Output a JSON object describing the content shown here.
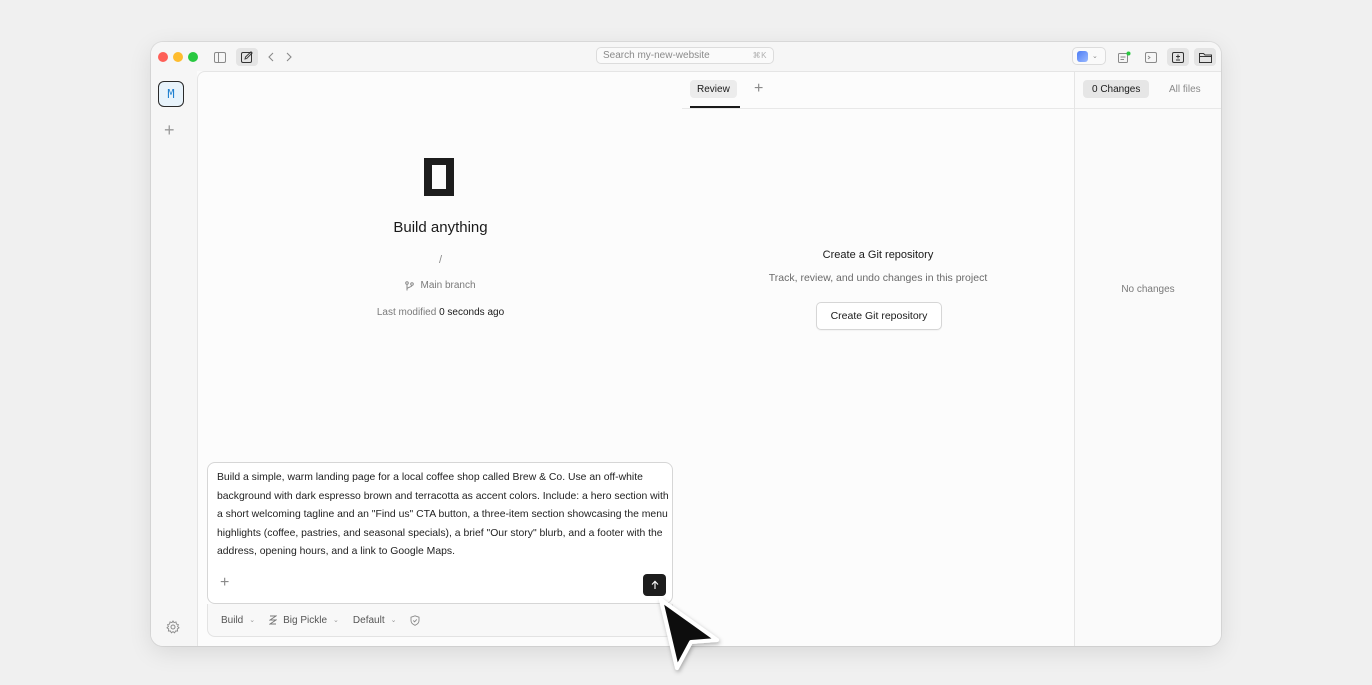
{
  "titlebar": {
    "search_placeholder": "Search my-new-website",
    "search_shortcut": "⌘K"
  },
  "rail": {
    "project_initial": "M"
  },
  "session": {
    "title": "Build anything",
    "path": "/",
    "branch": "Main branch",
    "modified_label": "Last modified",
    "modified_value": "0 seconds ago"
  },
  "composer": {
    "prompt": "Build a simple, warm landing page for a local coffee shop called Brew & Co. Use an off-white background with dark espresso brown and terracotta as accent colors. Include: a hero section with a short welcoming tagline and an \"Find us\" CTA button, a three-item section showcasing the menu highlights (coffee, pastries, and seasonal specials), a brief \"Our story\" blurb, and a footer with the address, opening hours, and a link to Google Maps.",
    "agent": "Build",
    "model": "Big Pickle",
    "variant": "Default"
  },
  "review": {
    "tab_label": "Review",
    "git_title": "Create a Git repository",
    "git_description": "Track, review, and undo changes in this project",
    "git_button": "Create Git repository"
  },
  "changes": {
    "tab_changes": "0 Changes",
    "tab_all_files": "All files",
    "empty_text": "No changes"
  },
  "colors": {
    "accent_blue": "#1e7fcf",
    "send_button": "#1d1d1d",
    "traffic_red": "#fe5f57",
    "traffic_yellow": "#febc2e",
    "traffic_green": "#28c840"
  }
}
